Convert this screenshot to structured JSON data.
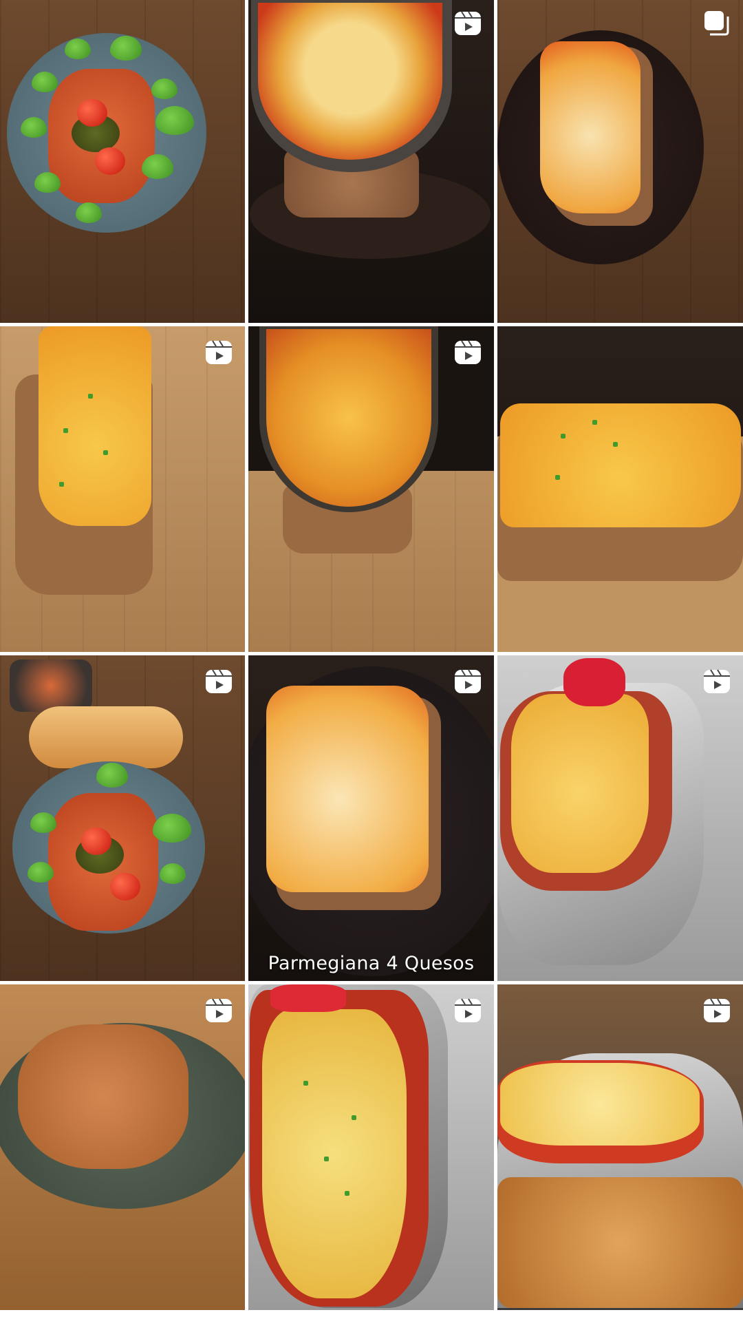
{
  "grid": {
    "tiles": [
      {
        "id": 1,
        "badge": "none",
        "caption": ""
      },
      {
        "id": 2,
        "badge": "reel-icon",
        "caption": ""
      },
      {
        "id": 3,
        "badge": "carousel-icon",
        "caption": ""
      },
      {
        "id": 4,
        "badge": "reel-icon",
        "caption": ""
      },
      {
        "id": 5,
        "badge": "reel-icon",
        "caption": ""
      },
      {
        "id": 6,
        "badge": "none",
        "caption": ""
      },
      {
        "id": 7,
        "badge": "reel-icon",
        "caption": ""
      },
      {
        "id": 8,
        "badge": "reel-icon",
        "caption": "Parmegiana 4 Quesos"
      },
      {
        "id": 9,
        "badge": "reel-icon",
        "caption": ""
      },
      {
        "id": 10,
        "badge": "reel-icon",
        "caption": ""
      },
      {
        "id": 11,
        "badge": "reel-icon",
        "caption": ""
      },
      {
        "id": 12,
        "badge": "reel-icon",
        "caption": ""
      }
    ]
  },
  "colors": {
    "cheese": "#f3b631",
    "sauce": "#d2421d",
    "crust": "#a9744a",
    "plate_blue": "#5c7680",
    "plate_dark": "#2a1e1a",
    "badge": "#ffffff"
  }
}
